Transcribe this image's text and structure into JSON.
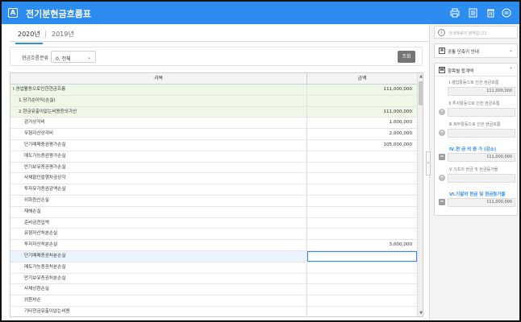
{
  "window": {
    "title": "전기분현금흐름표"
  },
  "colors": {
    "accent": "#2d8cf0",
    "highlight_row": "#eef8e6",
    "panel_bg": "#f3f3f3"
  },
  "toolbar": {
    "icons": [
      "print-icon",
      "copy-icon",
      "delete-icon",
      "menu-icon"
    ]
  },
  "tabs": [
    {
      "label": "2020년",
      "active": true
    },
    {
      "label": "2019년",
      "active": false
    }
  ],
  "filter": {
    "label": "현금흐름분류",
    "select_value": "0. 전체",
    "query_button": "조회"
  },
  "table": {
    "headers": [
      "과목",
      "금액"
    ],
    "rows": [
      {
        "subject": "Ⅰ.영업활동으로인한현금흐름",
        "amount": "111,000,000",
        "highlight": true
      },
      {
        "subject": "1.당기순이익(손실)",
        "amount": "",
        "highlight": true
      },
      {
        "subject": "2.현금유출이없는비용등의가산",
        "amount": "111,000,000",
        "highlight": true
      },
      {
        "subject": "감가상각비",
        "amount": "1,000,000"
      },
      {
        "subject": "무형자산상각비",
        "amount": "2,000,000"
      },
      {
        "subject": "단기매매증권평가손실",
        "amount": "105,000,000"
      },
      {
        "subject": "매도가능증권평가손실",
        "amount": ""
      },
      {
        "subject": "만기보유증권평가손실",
        "amount": ""
      },
      {
        "subject": "사채할인발행차금상각",
        "amount": ""
      },
      {
        "subject": "투자유가증권감액손실",
        "amount": ""
      },
      {
        "subject": "외화환산손실",
        "amount": ""
      },
      {
        "subject": "재해손실",
        "amount": ""
      },
      {
        "subject": "준비금전입액",
        "amount": ""
      },
      {
        "subject": "유형자산처분손실",
        "amount": ""
      },
      {
        "subject": "투자자산처분손실",
        "amount": "3,000,000"
      },
      {
        "subject": "단기매매증권처분손실",
        "amount": "",
        "selected": true
      },
      {
        "subject": "매도가능증권처분손실",
        "amount": ""
      },
      {
        "subject": "만기보유증권처분손실",
        "amount": ""
      },
      {
        "subject": "사채상환손실",
        "amount": ""
      },
      {
        "subject": "외환차손",
        "amount": ""
      },
      {
        "subject": "기타현금유출이없는비용",
        "amount": ""
      }
    ]
  },
  "right_panel": {
    "info_placeholder": "안내메세지 영역입니다",
    "shortcut_section": "공통 단축키 안내",
    "summary_section": "항목별 합계액",
    "summary": [
      {
        "label": "Ⅰ.영업활동으로 인한 현금흐름",
        "value": "111,000,000",
        "op": ""
      },
      {
        "label": "Ⅱ.투자활동으로 인한 현금흐름",
        "value": "",
        "op": "+"
      },
      {
        "label": "Ⅲ.재무활동으로 인한 현금흐름",
        "value": "",
        "op": "+"
      },
      {
        "label": "Ⅳ.현 금 의 증 가 (감소)",
        "value": "111,000,000",
        "op": "=",
        "highlight": true
      },
      {
        "label": "Ⅴ.기초의 현금 및 현금등가물",
        "value": "",
        "op": "+"
      },
      {
        "label": "Ⅵ.기말의 현금 및 현금등가물",
        "value": "111,000,000",
        "op": "=",
        "highlight": true
      }
    ]
  }
}
